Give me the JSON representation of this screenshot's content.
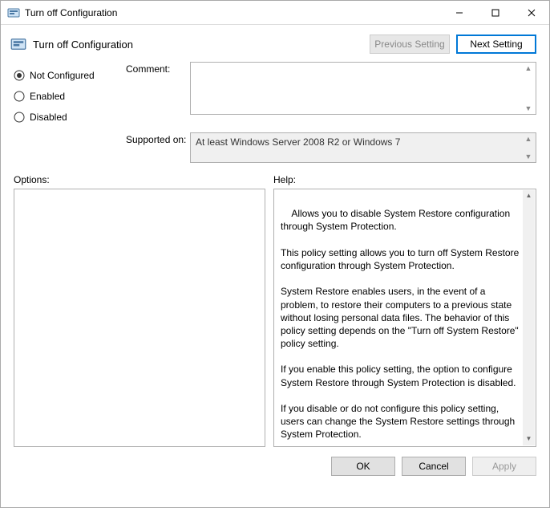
{
  "window": {
    "title": "Turn off Configuration"
  },
  "header": {
    "title": "Turn off Configuration",
    "previous": "Previous Setting",
    "next": "Next Setting"
  },
  "radios": {
    "not_configured": "Not Configured",
    "enabled": "Enabled",
    "disabled": "Disabled",
    "selected": "not_configured"
  },
  "labels": {
    "comment": "Comment:",
    "supported": "Supported on:",
    "options": "Options:",
    "help": "Help:"
  },
  "comment": "",
  "supported_on": "At least Windows Server 2008 R2 or Windows 7",
  "options_content": "",
  "help_text": "Allows you to disable System Restore configuration through System Protection.\n\nThis policy setting allows you to turn off System Restore configuration through System Protection.\n\nSystem Restore enables users, in the event of a problem, to restore their computers to a previous state without losing personal data files. The behavior of this policy setting depends on the \"Turn off System Restore\" policy setting.\n\nIf you enable this policy setting, the option to configure System Restore through System Protection is disabled.\n\nIf you disable or do not configure this policy setting, users can change the System Restore settings through System Protection.\n\nAlso, see the \"Turn off System Restore\" policy setting. If the \"Turn off System Restore\" policy setting is enabled, the \"Turn off System Restore configuration\" policy setting is overwritten.",
  "buttons": {
    "ok": "OK",
    "cancel": "Cancel",
    "apply": "Apply"
  }
}
